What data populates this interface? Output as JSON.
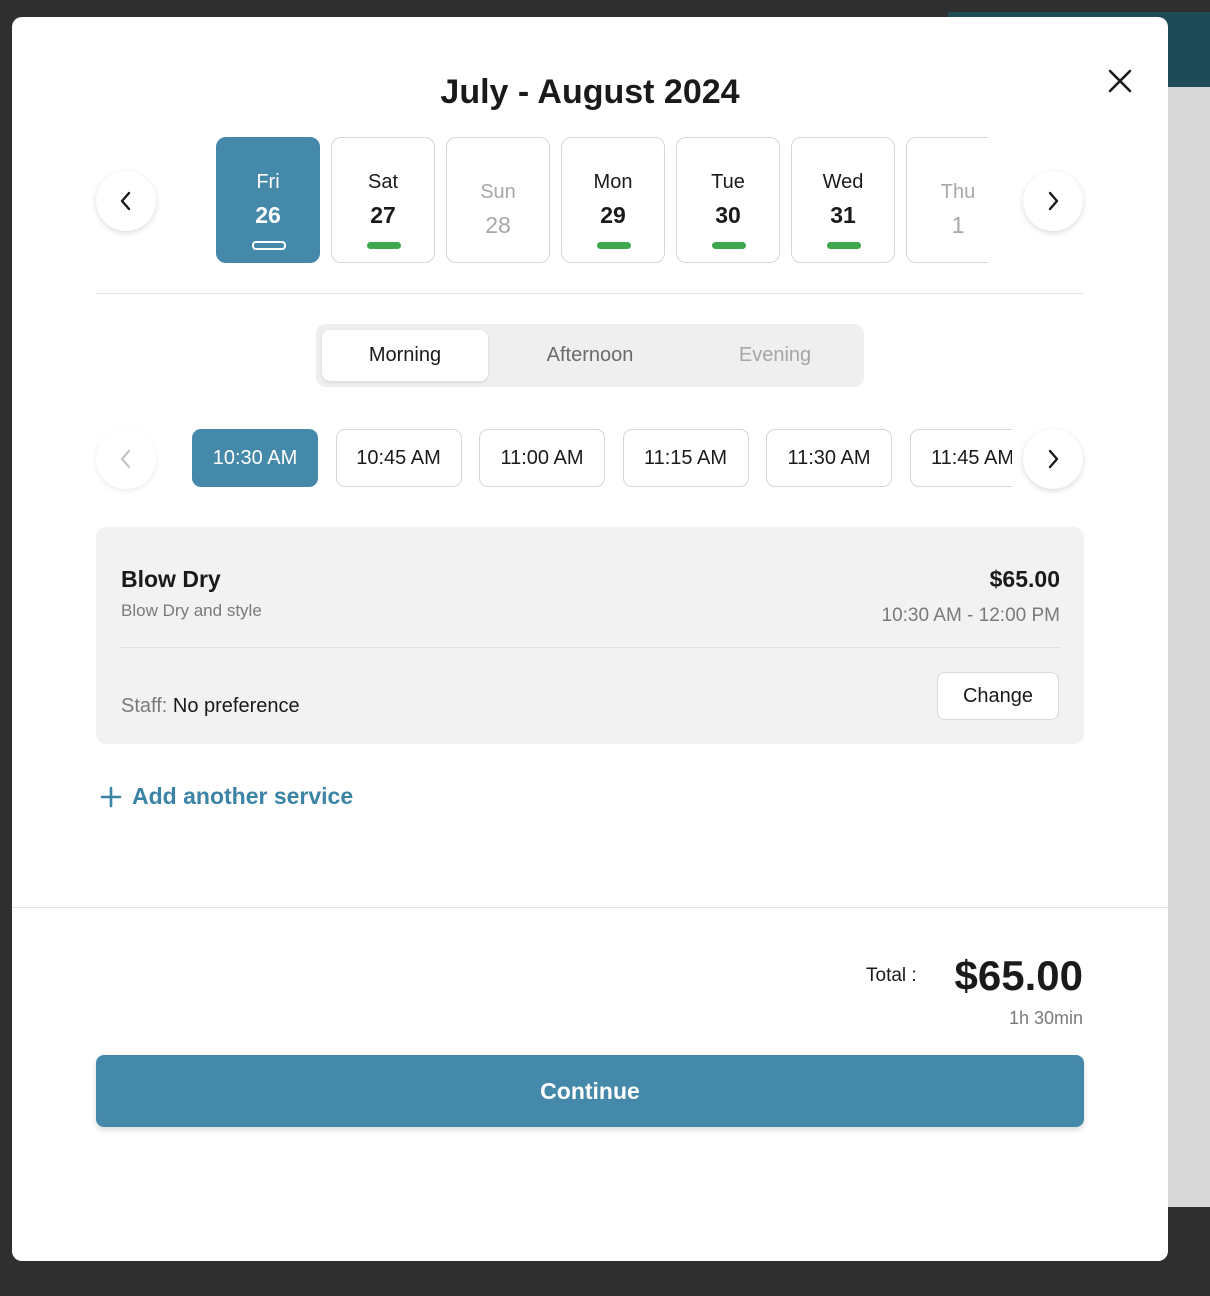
{
  "header": {
    "title": "July - August 2024",
    "close_icon": "close-icon"
  },
  "dates": [
    {
      "dow": "Fri",
      "num": "26",
      "state": "selected"
    },
    {
      "dow": "Sat",
      "num": "27",
      "state": "available"
    },
    {
      "dow": "Sun",
      "num": "28",
      "state": "unavailable"
    },
    {
      "dow": "Mon",
      "num": "29",
      "state": "available"
    },
    {
      "dow": "Tue",
      "num": "30",
      "state": "available"
    },
    {
      "dow": "Wed",
      "num": "31",
      "state": "available"
    },
    {
      "dow": "Thu",
      "num": "1",
      "state": "unavailable"
    }
  ],
  "periods": [
    {
      "label": "Morning",
      "state": "active"
    },
    {
      "label": "Afternoon",
      "state": "inactive"
    },
    {
      "label": "Evening",
      "state": "disabled"
    }
  ],
  "times": [
    "10:30 AM",
    "10:45 AM",
    "11:00 AM",
    "11:15 AM",
    "11:30 AM",
    "11:45 AM"
  ],
  "selected_time": "10:30 AM",
  "service": {
    "name": "Blow Dry",
    "description": "Blow Dry and style",
    "price": "$65.00",
    "time_range": "10:30 AM - 12:00 PM",
    "staff_label": "Staff:",
    "staff_value": "No preference",
    "change_label": "Change"
  },
  "add_service_label": "Add another service",
  "totals": {
    "label": "Total :",
    "amount": "$65.00",
    "duration": "1h 30min"
  },
  "continue_label": "Continue",
  "colors": {
    "accent": "#4589aa",
    "available": "#3ea84f",
    "link": "#3b84a5"
  }
}
